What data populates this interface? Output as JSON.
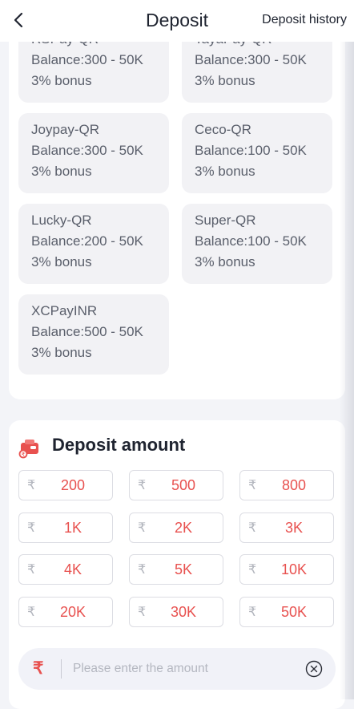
{
  "header": {
    "title": "Deposit",
    "history_label": "Deposit history"
  },
  "channels": [
    {
      "name": "RSPay-QR",
      "balance": "Balance:300 - 50K",
      "bonus": "3% bonus"
    },
    {
      "name": "TayaPay-QR",
      "balance": "Balance:300 - 50K",
      "bonus": "3% bonus"
    },
    {
      "name": "Joypay-QR",
      "balance": "Balance:300 - 50K",
      "bonus": "3% bonus"
    },
    {
      "name": "Ceco-QR",
      "balance": "Balance:100 - 50K",
      "bonus": "3% bonus"
    },
    {
      "name": "Lucky-QR",
      "balance": "Balance:200 - 50K",
      "bonus": "3% bonus"
    },
    {
      "name": "Super-QR",
      "balance": "Balance:100 - 50K",
      "bonus": "3% bonus"
    },
    {
      "name": "XCPayINR",
      "balance": "Balance:500 - 50K",
      "bonus": "3% bonus"
    }
  ],
  "deposit_amount": {
    "title": "Deposit amount",
    "currency_symbol": "₹",
    "options": [
      "200",
      "500",
      "800",
      "1K",
      "2K",
      "3K",
      "4K",
      "5K",
      "10K",
      "20K",
      "30K",
      "50K"
    ],
    "input_placeholder": "Please enter the amount",
    "input_value": ""
  },
  "colors": {
    "accent": "#e8514f",
    "page_bg": "#f3f4f8",
    "card_bg": "#f2f2f5"
  },
  "icons": {
    "back": "chevron-left-icon",
    "amount": "wallet-icon",
    "clear": "close-circle-icon"
  }
}
